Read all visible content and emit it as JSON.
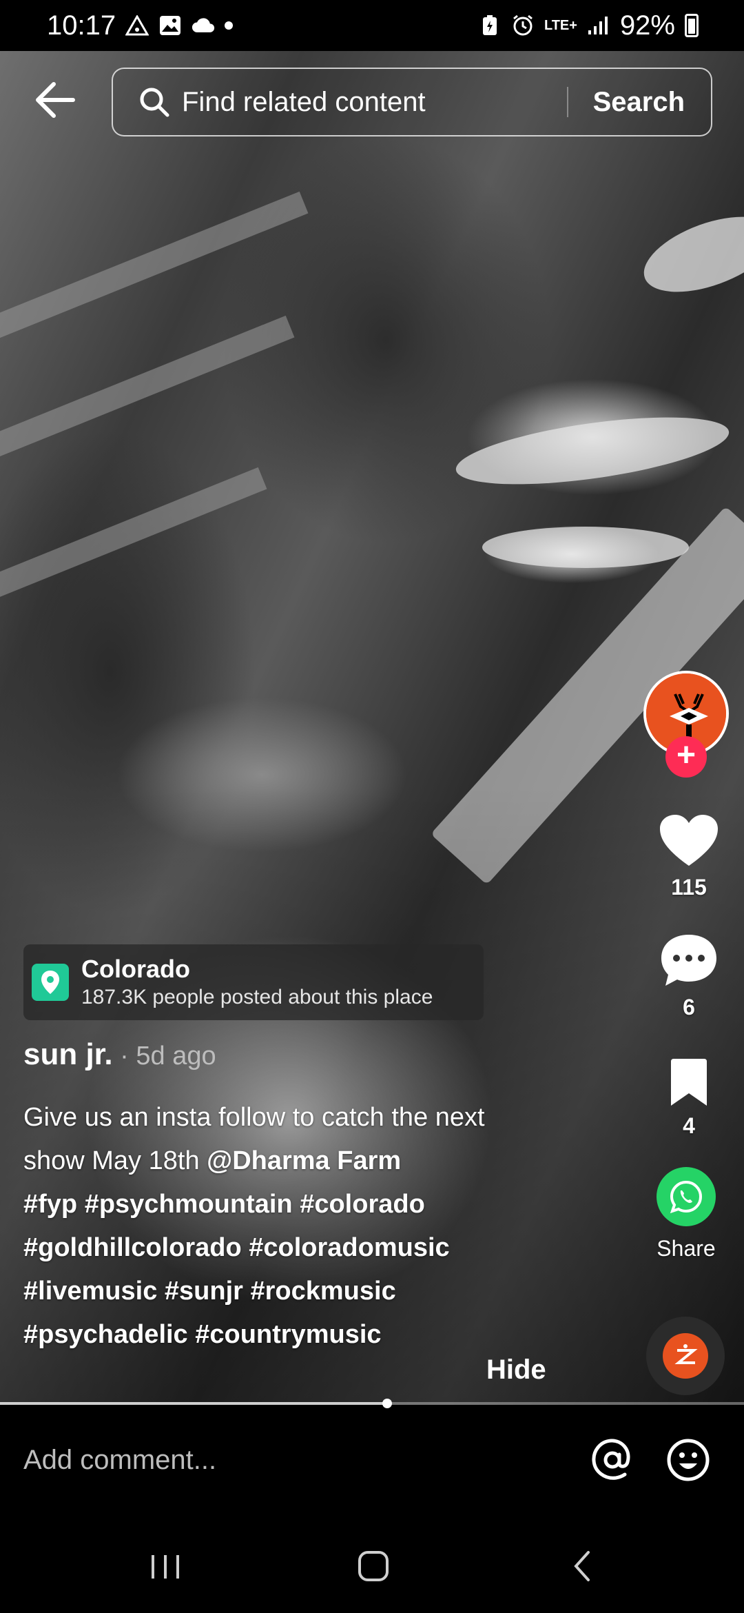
{
  "status_bar": {
    "time": "10:17",
    "battery": "92%",
    "network": "LTE+",
    "icons_left": [
      "warning-icon",
      "gallery-icon",
      "cloud-icon",
      "dot-icon"
    ],
    "icons_right": [
      "battery-saver-icon",
      "alarm-icon",
      "network-icon",
      "signal-icon",
      "battery-icon"
    ]
  },
  "header": {
    "back_icon": "arrow-left-icon",
    "search_placeholder": "Find related content",
    "search_button": "Search"
  },
  "rail": {
    "likes": "115",
    "comments": "6",
    "bookmarks": "4",
    "share_label": "Share"
  },
  "location": {
    "name": "Colorado",
    "subtitle": "187.3K people posted about this place"
  },
  "post": {
    "author": "sun jr.",
    "time": " · 5d ago",
    "caption_text": "Give us an insta follow to catch the next show May 18th ",
    "mention": "@Dharma Farm",
    "hashtags_line1": "#fyp #psychmountain #colorado",
    "hashtags_line2": "#goldhillcolorado #coloradomusic",
    "hashtags_line3": "#livemusic #sunjr #rockmusic",
    "hashtags_line4": "#psychadelic #countrymusic",
    "hide_label": "Hide"
  },
  "progress": {
    "fraction": 0.52
  },
  "comment_bar": {
    "placeholder": "Add comment..."
  },
  "colors": {
    "accent_pink": "#fe2c55",
    "whatsapp_green": "#25d366",
    "location_green": "#20c997",
    "avatar_orange": "#e8521f"
  }
}
